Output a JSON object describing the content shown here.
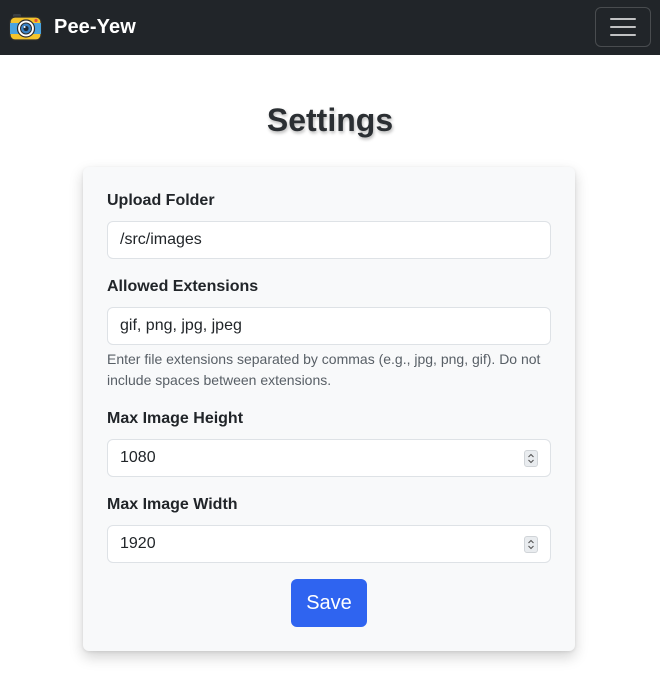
{
  "navbar": {
    "brand": "Pee-Yew",
    "logo_icon": "camera-logo-icon",
    "menu_icon": "hamburger-menu-icon"
  },
  "page": {
    "title": "Settings"
  },
  "form": {
    "upload_folder": {
      "label": "Upload Folder",
      "value": "/src/images"
    },
    "allowed_extensions": {
      "label": "Allowed Extensions",
      "value": "gif, png, jpg, jpeg",
      "help": "Enter file extensions separated by commas (e.g., jpg, png, gif). Do not include spaces between extensions."
    },
    "max_height": {
      "label": "Max Image Height",
      "value": "1080"
    },
    "max_width": {
      "label": "Max Image Width",
      "value": "1920"
    },
    "save_label": "Save"
  },
  "colors": {
    "navbar_bg": "#212529",
    "card_bg": "#f8f9fa",
    "primary": "#2f64f0"
  }
}
